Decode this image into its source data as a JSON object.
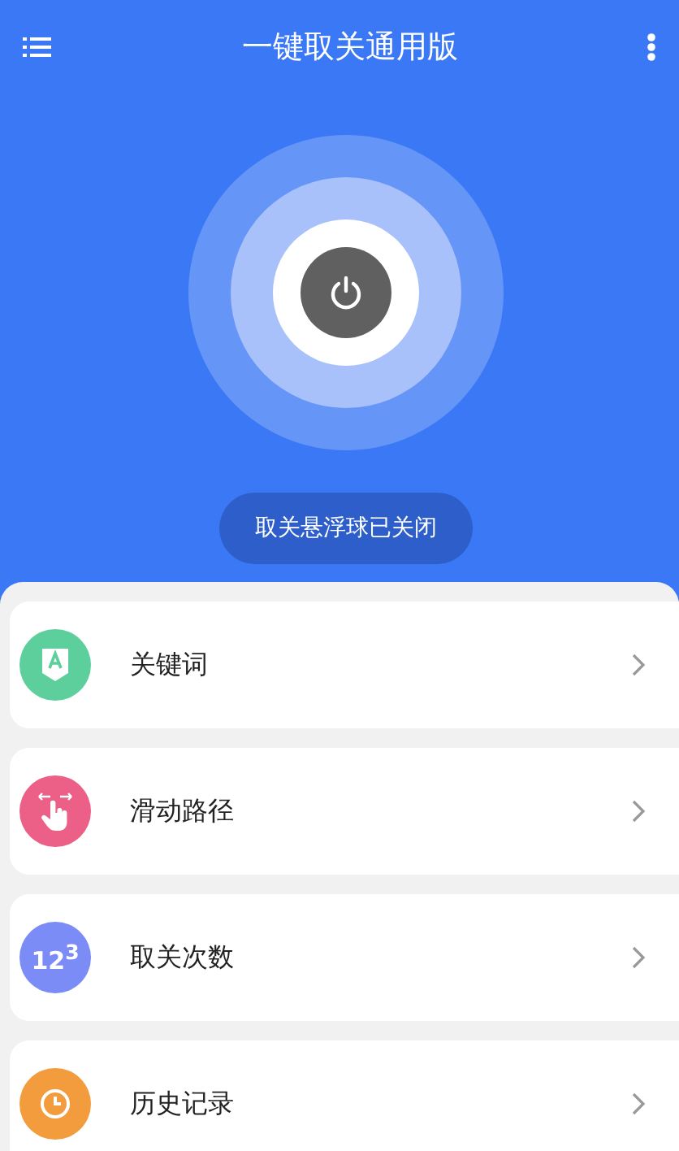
{
  "header": {
    "title": "一键取关通用版"
  },
  "power": {
    "on": false
  },
  "status": "取关悬浮球已关闭",
  "menu": [
    {
      "kind": "keyword",
      "label": "关键词",
      "color": "#5ccf9c"
    },
    {
      "kind": "swipe",
      "label": "滑动路径",
      "color": "#ec5f86"
    },
    {
      "kind": "count",
      "label": "取关次数",
      "color": "#7b8cf6",
      "icon_text": "12$^{3}$"
    },
    {
      "kind": "history",
      "label": "历史记录",
      "color": "#f39c3e"
    }
  ]
}
